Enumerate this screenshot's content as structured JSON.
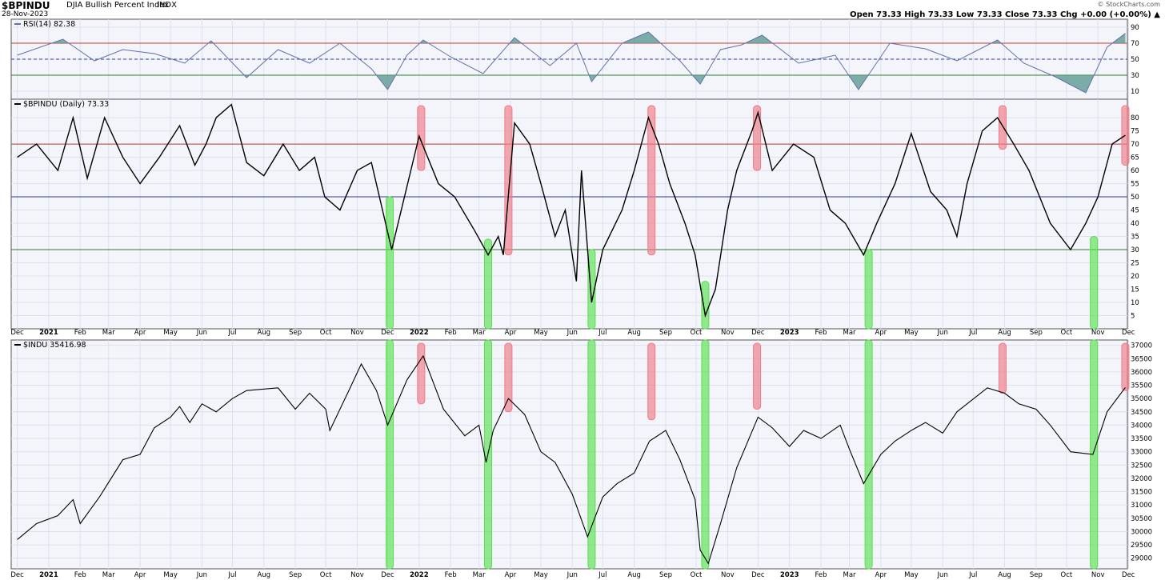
{
  "header": {
    "symbol": "$BPINDU",
    "name": "DJIA Bullish Percent Index",
    "exchange": "INDX",
    "date": "28-Nov-2023",
    "credit": "© StockCharts.com",
    "quote": "Open 73.33  High 73.33  Low 73.33  Close 73.33  Chg +0.00 (+0.00%) ▲"
  },
  "colors": {
    "panel_bg": "#f4f5fb",
    "grid": "#dcdff0",
    "line": "#000000",
    "rsi_line": "#6270a8",
    "rsi_fill": "#5d9a92",
    "overbought_line": "#c0392b",
    "midline": "#2c3e96",
    "oversold_line": "#2e7d32",
    "green_highlight": "#59e04e",
    "red_highlight": "#f07b86"
  },
  "x_axis_labels": [
    "Dec",
    "2021",
    "Feb",
    "Mar",
    "Apr",
    "May",
    "Jun",
    "Jul",
    "Aug",
    "Sep",
    "Oct",
    "Nov",
    "Dec",
    "2022",
    "Feb",
    "Mar",
    "Apr",
    "May",
    "Jun",
    "Jul",
    "Aug",
    "Sep",
    "Oct",
    "Nov",
    "Dec",
    "2023",
    "Feb",
    "Mar",
    "Apr",
    "May",
    "Jun",
    "Jul",
    "Aug",
    "Sep",
    "Oct",
    "Nov",
    "Dec"
  ],
  "chart_data": [
    {
      "type": "line",
      "title": "RSI(14) 82.38",
      "yticks": [
        10,
        30,
        50,
        70,
        90
      ],
      "ylim": [
        0,
        100
      ],
      "reference_lines": [
        30,
        50,
        70
      ],
      "x": [
        "2020-12-01",
        "2021-01-15",
        "2021-02-15",
        "2021-03-15",
        "2021-04-15",
        "2021-05-15",
        "2021-06-10",
        "2021-07-15",
        "2021-08-15",
        "2021-09-15",
        "2021-10-15",
        "2021-11-15",
        "2021-12-01",
        "2021-12-20",
        "2022-01-05",
        "2022-02-01",
        "2022-03-05",
        "2022-04-05",
        "2022-05-10",
        "2022-06-05",
        "2022-06-20",
        "2022-07-20",
        "2022-08-15",
        "2022-09-15",
        "2022-10-05",
        "2022-10-25",
        "2022-11-15",
        "2022-12-05",
        "2023-01-10",
        "2023-02-15",
        "2023-03-10",
        "2023-04-10",
        "2023-05-15",
        "2023-06-15",
        "2023-07-25",
        "2023-08-20",
        "2023-09-20",
        "2023-10-20",
        "2023-11-10",
        "2023-11-28"
      ],
      "values": [
        55,
        75,
        48,
        62,
        57,
        45,
        73,
        27,
        62,
        45,
        70,
        38,
        12,
        55,
        74,
        53,
        32,
        77,
        42,
        70,
        22,
        70,
        84,
        48,
        19,
        62,
        68,
        80,
        45,
        55,
        12,
        70,
        63,
        48,
        74,
        45,
        28,
        8,
        65,
        82.38
      ]
    },
    {
      "type": "line",
      "title": "$BPINDU (Daily) 73.33",
      "series": [
        {
          "name": "$BPINDU (Daily)",
          "values": [
            65,
            70,
            60,
            80,
            57,
            80,
            65,
            55,
            65,
            77,
            62,
            70,
            80,
            85,
            63,
            58,
            70,
            60,
            65,
            50,
            45,
            60,
            63,
            30,
            73,
            55,
            50,
            37,
            28,
            35,
            28,
            78,
            70,
            55,
            35,
            45,
            18,
            60,
            10,
            30,
            45,
            60,
            80,
            70,
            55,
            40,
            28,
            5,
            15,
            45,
            60,
            75,
            82,
            60,
            70,
            65,
            45,
            40,
            28,
            40,
            55,
            74,
            52,
            45,
            35,
            55,
            75,
            80,
            70,
            60,
            40,
            30,
            40,
            50,
            70,
            73.33
          ]
        }
      ],
      "x": [
        "2020-12-01",
        "2020-12-20",
        "2021-01-10",
        "2021-01-25",
        "2021-02-08",
        "2021-02-25",
        "2021-03-15",
        "2021-04-01",
        "2021-04-20",
        "2021-05-10",
        "2021-05-25",
        "2021-06-05",
        "2021-06-15",
        "2021-06-30",
        "2021-07-15",
        "2021-08-01",
        "2021-08-20",
        "2021-09-05",
        "2021-09-20",
        "2021-09-30",
        "2021-10-15",
        "2021-11-01",
        "2021-11-15",
        "2021-12-05",
        "2022-01-01",
        "2022-01-20",
        "2022-02-05",
        "2022-02-25",
        "2022-03-10",
        "2022-03-20",
        "2022-03-25",
        "2022-04-05",
        "2022-04-20",
        "2022-05-01",
        "2022-05-15",
        "2022-05-25",
        "2022-06-05",
        "2022-06-10",
        "2022-06-20",
        "2022-07-01",
        "2022-07-20",
        "2022-08-01",
        "2022-08-15",
        "2022-08-25",
        "2022-09-05",
        "2022-09-20",
        "2022-09-30",
        "2022-10-10",
        "2022-10-20",
        "2022-11-01",
        "2022-11-10",
        "2022-11-25",
        "2022-12-01",
        "2022-12-15",
        "2023-01-05",
        "2023-01-25",
        "2023-02-10",
        "2023-02-25",
        "2023-03-15",
        "2023-03-28",
        "2023-04-15",
        "2023-05-01",
        "2023-05-20",
        "2023-06-05",
        "2023-06-15",
        "2023-06-25",
        "2023-07-10",
        "2023-07-25",
        "2023-08-10",
        "2023-08-25",
        "2023-09-15",
        "2023-10-05",
        "2023-10-20",
        "2023-11-01",
        "2023-11-15",
        "2023-11-28"
      ],
      "yticks": [
        5,
        10,
        15,
        20,
        25,
        30,
        35,
        40,
        45,
        50,
        55,
        60,
        65,
        70,
        75,
        80
      ],
      "ylim": [
        0,
        87
      ],
      "reference_lines": [
        30,
        50,
        70
      ]
    },
    {
      "type": "line",
      "title": "$INDU 35416.98",
      "series": [
        {
          "name": "$INDU",
          "values": [
            29700,
            30300,
            30600,
            31200,
            30300,
            31300,
            32700,
            32900,
            33900,
            34300,
            34700,
            34100,
            34800,
            34500,
            35000,
            35300,
            35400,
            34600,
            35200,
            34600,
            33800,
            35400,
            36300,
            35300,
            34000,
            35700,
            36600,
            34600,
            33600,
            34000,
            32600,
            33800,
            35000,
            34400,
            33000,
            32600,
            31400,
            29800,
            31300,
            31800,
            32200,
            33400,
            33800,
            32700,
            31200,
            29300,
            28800,
            30300,
            32400,
            34300,
            33900,
            33200,
            33800,
            33500,
            34000,
            33100,
            31800,
            32900,
            33400,
            33800,
            34100,
            33700,
            34500,
            35400,
            35200,
            34800,
            34600,
            34000,
            33000,
            32900,
            34500,
            35416.98
          ]
        }
      ],
      "x": [
        "2020-12-01",
        "2020-12-20",
        "2021-01-10",
        "2021-01-25",
        "2021-02-01",
        "2021-02-20",
        "2021-03-15",
        "2021-04-01",
        "2021-04-15",
        "2021-05-01",
        "2021-05-10",
        "2021-05-20",
        "2021-06-01",
        "2021-06-15",
        "2021-07-01",
        "2021-07-15",
        "2021-08-15",
        "2021-09-01",
        "2021-09-15",
        "2021-10-01",
        "2021-10-05",
        "2021-10-25",
        "2021-11-05",
        "2021-11-20",
        "2021-12-01",
        "2021-12-20",
        "2022-01-05",
        "2022-01-25",
        "2022-02-15",
        "2022-03-01",
        "2022-03-08",
        "2022-03-15",
        "2022-03-30",
        "2022-04-15",
        "2022-05-01",
        "2022-05-15",
        "2022-06-01",
        "2022-06-16",
        "2022-07-01",
        "2022-07-15",
        "2022-08-01",
        "2022-08-16",
        "2022-09-01",
        "2022-09-15",
        "2022-09-30",
        "2022-10-05",
        "2022-10-13",
        "2022-10-25",
        "2022-11-10",
        "2022-12-01",
        "2022-12-15",
        "2023-01-01",
        "2023-01-15",
        "2023-02-01",
        "2023-02-20",
        "2023-03-01",
        "2023-03-15",
        "2023-04-01",
        "2023-04-15",
        "2023-05-01",
        "2023-05-15",
        "2023-06-01",
        "2023-06-15",
        "2023-07-15",
        "2023-08-01",
        "2023-08-15",
        "2023-09-01",
        "2023-09-15",
        "2023-10-05",
        "2023-10-27",
        "2023-11-10",
        "2023-11-28"
      ],
      "yticks": [
        29000,
        29500,
        30000,
        30500,
        31000,
        31500,
        32000,
        32500,
        33000,
        33500,
        34000,
        34500,
        35000,
        35500,
        36000,
        36500,
        37000
      ],
      "ylim": [
        28600,
        37200
      ]
    }
  ],
  "highlights": {
    "green": [
      "2021-12-03",
      "2022-03-10",
      "2022-06-20",
      "2022-10-10",
      "2023-03-20",
      "2023-10-28"
    ],
    "red": [
      "2022-01-03",
      "2022-03-30",
      "2022-08-18",
      "2022-11-30",
      "2023-07-30",
      "2023-11-28"
    ]
  }
}
